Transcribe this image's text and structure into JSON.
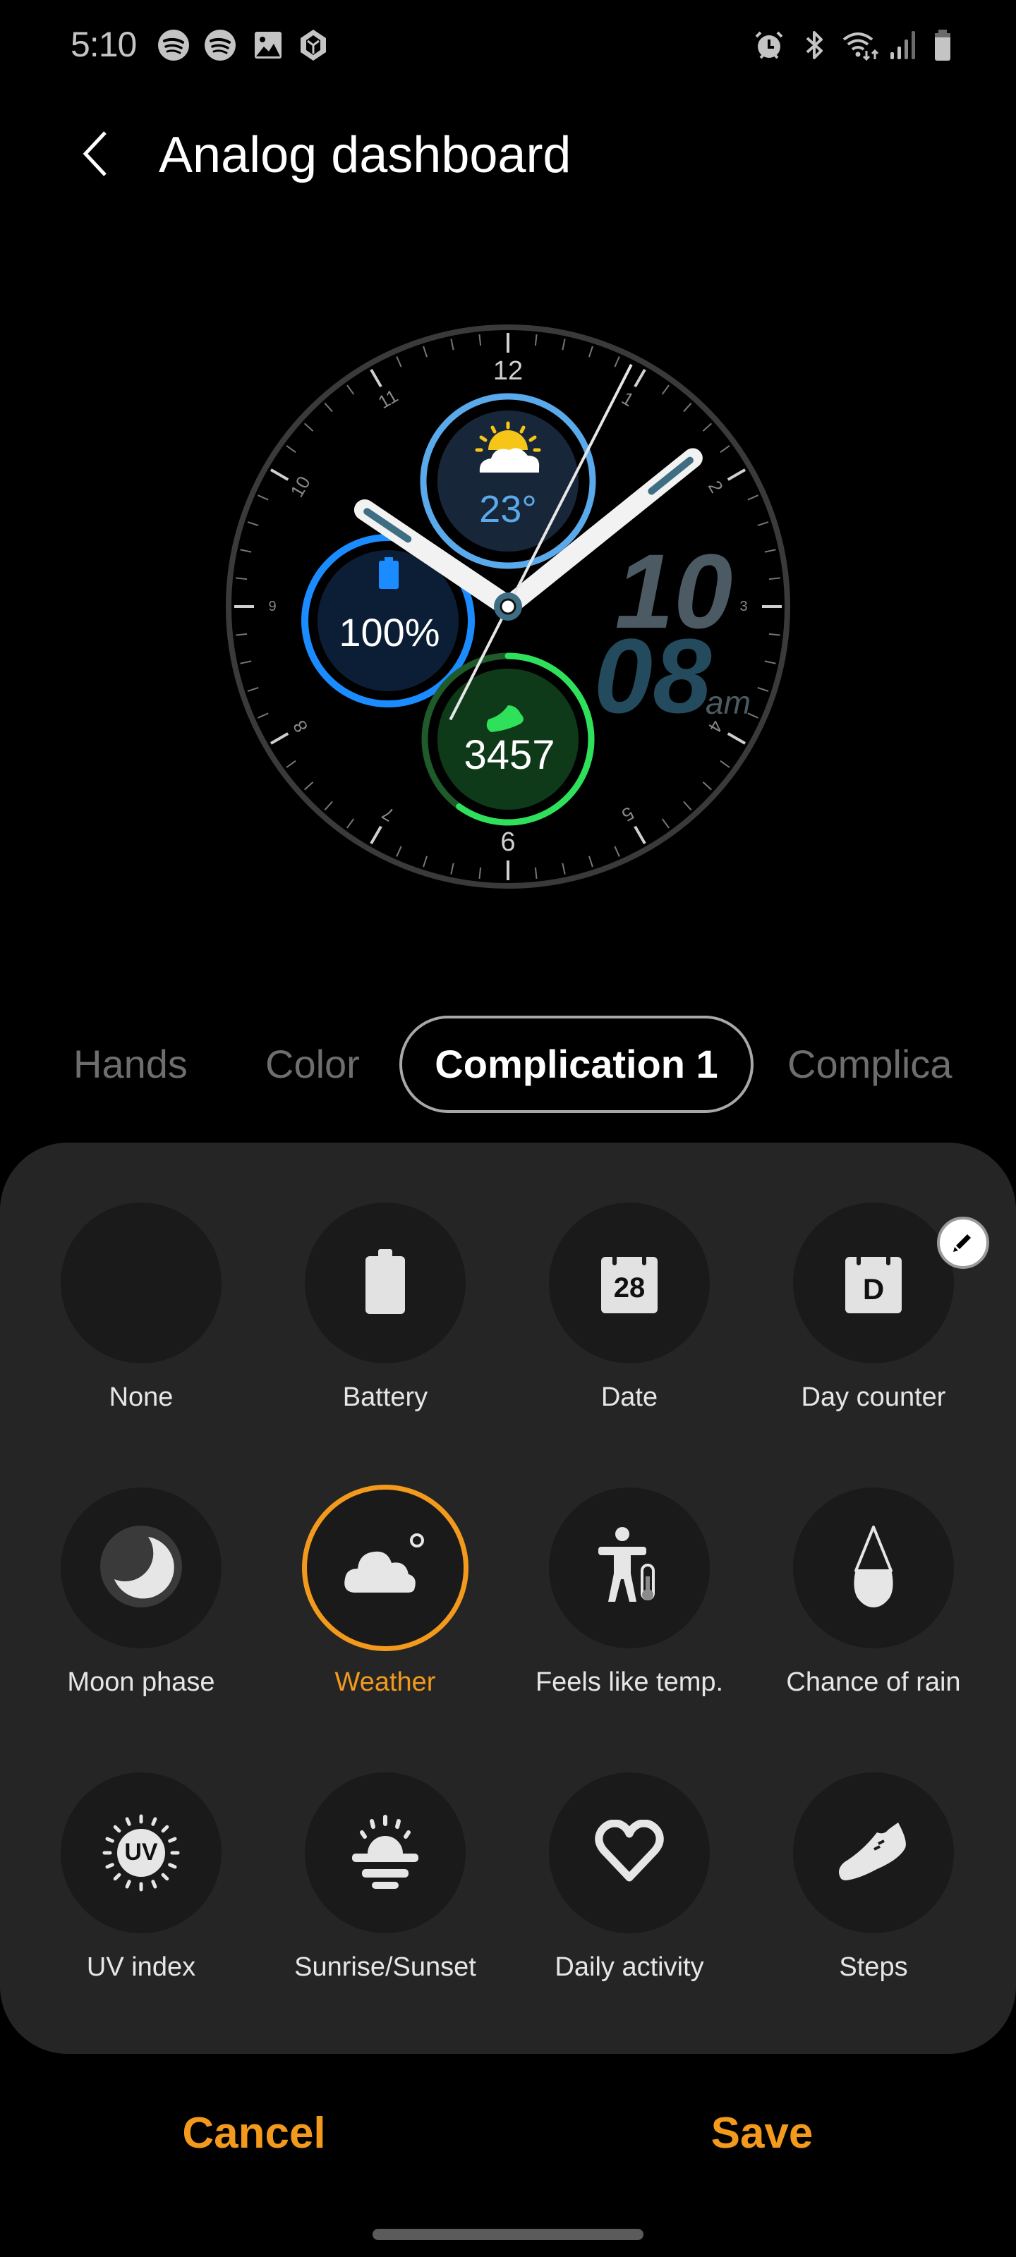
{
  "status_bar": {
    "time": "5:10",
    "left_icons": [
      "spotify-icon",
      "spotify-icon",
      "gallery-icon",
      "app-box-icon"
    ],
    "right_icons": [
      "alarm-icon",
      "bluetooth-icon",
      "wifi-icon",
      "signal-icon",
      "battery-icon"
    ]
  },
  "header": {
    "back_icon": "chevron-left-icon",
    "title": "Analog dashboard"
  },
  "watch_face": {
    "dial_numbers": [
      "12",
      "1",
      "2",
      "3",
      "4",
      "5",
      "6",
      "7",
      "8",
      "9",
      "10",
      "11"
    ],
    "weather": {
      "temperature": "23°",
      "icon": "partly-sunny-icon",
      "color": "#5aa9ea"
    },
    "battery": {
      "value": "100%",
      "icon": "battery-icon",
      "color": "#1a8cff",
      "level": 1.0
    },
    "steps": {
      "value": "3457",
      "icon": "shoe-icon",
      "color": "#2ee05a",
      "progress": 0.6
    },
    "digital_time": {
      "hour": "10",
      "minute": "08",
      "ampm": "am"
    },
    "hands": {
      "hour": 10,
      "minute": 8,
      "second": 32
    }
  },
  "tabs": [
    {
      "label": "Hands",
      "active": false
    },
    {
      "label": "Color",
      "active": false
    },
    {
      "label": "Complication 1",
      "active": true
    },
    {
      "label": "Complica",
      "active": false
    }
  ],
  "complications": [
    {
      "label": "None",
      "icon": "none",
      "selected": false
    },
    {
      "label": "Battery",
      "icon": "battery-icon",
      "selected": false
    },
    {
      "label": "Date",
      "icon": "calendar-icon",
      "icon_text": "28",
      "selected": false
    },
    {
      "label": "Day counter",
      "icon": "day-counter-icon",
      "icon_text": "D",
      "selected": false,
      "editable": true
    },
    {
      "label": "Moon phase",
      "icon": "moon-icon",
      "selected": false
    },
    {
      "label": "Weather",
      "icon": "weather-cloud-icon",
      "selected": true
    },
    {
      "label": "Feels like temp.",
      "icon": "feels-like-icon",
      "selected": false
    },
    {
      "label": "Chance of rain",
      "icon": "raindrop-icon",
      "selected": false
    },
    {
      "label": "UV index",
      "icon": "uv-icon",
      "icon_text": "UV",
      "selected": false
    },
    {
      "label": "Sunrise/Sunset",
      "icon": "sunrise-icon",
      "selected": false
    },
    {
      "label": "Daily activity",
      "icon": "heart-icon",
      "selected": false
    },
    {
      "label": "Steps",
      "icon": "shoe-icon",
      "selected": false
    }
  ],
  "actions": {
    "cancel": "Cancel",
    "save": "Save"
  },
  "colors": {
    "accent": "#f39a1d",
    "panel": "#252525",
    "item_bg": "#1a1a1a"
  }
}
